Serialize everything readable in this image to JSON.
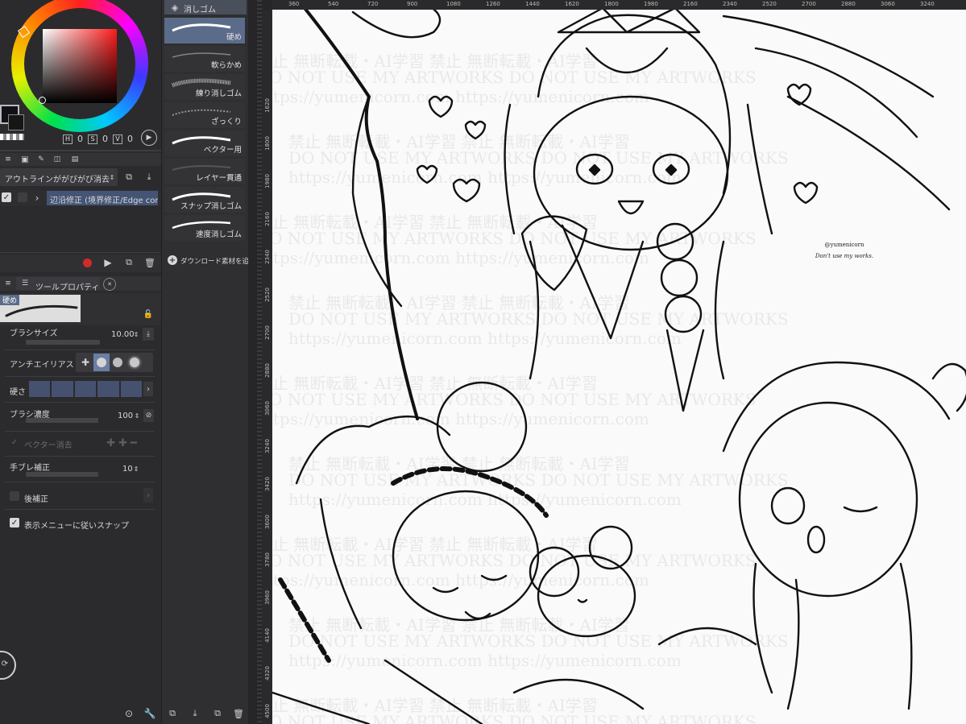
{
  "color": {
    "main_color": "#101018",
    "sub_color": "#ffffff",
    "hue_color": "#ff1b1b",
    "hsv_labels": [
      "H",
      "S",
      "V"
    ],
    "hsv_values": [
      "0",
      "0",
      "0"
    ]
  },
  "layer_panel": {
    "auto_action": "アウトラインががびがび消去",
    "layer_name": "辺沿修正 (境界修正/Edge corr"
  },
  "tool_property": {
    "tab_label": "ツールプロパティ",
    "preview_label": "硬め",
    "brush_size_label": "ブラシサイズ",
    "brush_size_value": "10.00",
    "antialias_label": "アンチエイリアス",
    "hardness_label": "硬さ",
    "density_label": "ブラシ濃度",
    "density_value": "100",
    "vector_erase_label": "ベクター消去",
    "stabilization_label": "手ブレ補正",
    "stabilization_value": "10",
    "post_correction_label": "後補正",
    "snap_label": "表示メニューに従いスナップ"
  },
  "sub_tool": {
    "group_label": "消しゴム",
    "items": [
      "硬め",
      "軟らかめ",
      "練り消しゴム",
      "ざっくり",
      "ベクター用",
      "レイヤー貫通",
      "スナップ消しゴム",
      "速度消しゴム"
    ],
    "download_label": "ダウンロード素材を追"
  },
  "ruler": {
    "top_ticks": [
      "360",
      "540",
      "720",
      "900",
      "1080",
      "1260",
      "1440",
      "1620",
      "1800",
      "1980",
      "2160",
      "2340",
      "2520",
      "2700",
      "2880",
      "3060",
      "3240"
    ],
    "left_ticks": [
      "1620",
      "1800",
      "1980",
      "2160",
      "2340",
      "2520",
      "2700",
      "2880",
      "3060",
      "3240",
      "3420",
      "3600",
      "3780",
      "3960",
      "4140",
      "4320",
      "4500"
    ]
  },
  "canvas": {
    "watermark_lines": [
      "禁止 無断転載・AI学習",
      "DO NOT USE MY ARTWORKS",
      "https://yumenicorn.com"
    ],
    "signature": [
      "@yumenicorn",
      "Don't use my works."
    ]
  }
}
